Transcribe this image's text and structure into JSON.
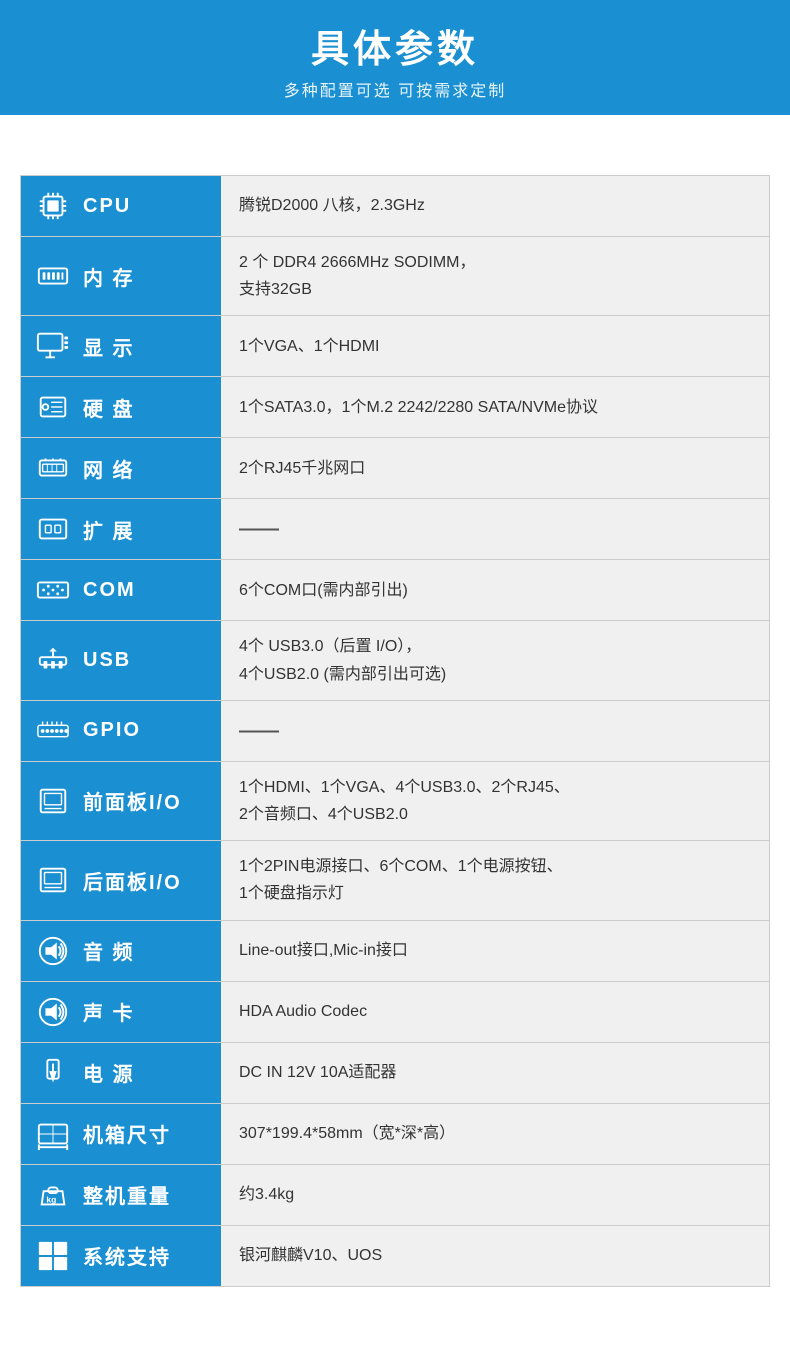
{
  "header": {
    "title": "具体参数",
    "subtitle": "多种配置可选 可按需求定制"
  },
  "rows": [
    {
      "id": "cpu",
      "label": "CPU",
      "value": "腾锐D2000 八核，2.3GHz",
      "icon": "cpu"
    },
    {
      "id": "memory",
      "label": "内 存",
      "value": "2 个 DDR4 2666MHz SODIMM，\n支持32GB",
      "icon": "memory"
    },
    {
      "id": "display",
      "label": "显 示",
      "value": "1个VGA、1个HDMI",
      "icon": "display"
    },
    {
      "id": "storage",
      "label": "硬 盘",
      "value": "1个SATA3.0，1个M.2 2242/2280 SATA/NVMe协议",
      "icon": "storage"
    },
    {
      "id": "network",
      "label": "网 络",
      "value": "2个RJ45千兆网口",
      "icon": "network"
    },
    {
      "id": "expansion",
      "label": "扩 展",
      "value": "——",
      "icon": "expansion"
    },
    {
      "id": "com",
      "label": "COM",
      "value": "6个COM口(需内部引出)",
      "icon": "com"
    },
    {
      "id": "usb",
      "label": "USB",
      "value": "4个 USB3.0（后置 I/O），\n4个USB2.0 (需内部引出可选)",
      "icon": "usb"
    },
    {
      "id": "gpio",
      "label": "GPIO",
      "value": "——",
      "icon": "gpio"
    },
    {
      "id": "front-io",
      "label": "前面板I/O",
      "value": "1个HDMI、1个VGA、4个USB3.0、2个RJ45、\n2个音频口、4个USB2.0",
      "icon": "front-panel"
    },
    {
      "id": "rear-io",
      "label": "后面板I/O",
      "value": "1个2PIN电源接口、6个COM、1个电源按钮、\n1个硬盘指示灯",
      "icon": "rear-panel"
    },
    {
      "id": "audio",
      "label": "音 频",
      "value": "Line-out接口,Mic-in接口",
      "icon": "audio"
    },
    {
      "id": "sound-card",
      "label": "声 卡",
      "value": "HDA Audio Codec",
      "icon": "sound-card"
    },
    {
      "id": "power",
      "label": "电 源",
      "value": "DC IN 12V 10A适配器",
      "icon": "power"
    },
    {
      "id": "size",
      "label": "机箱尺寸",
      "value": "307*199.4*58mm（宽*深*高）",
      "icon": "size"
    },
    {
      "id": "weight",
      "label": "整机重量",
      "value": "约3.4kg",
      "icon": "weight"
    },
    {
      "id": "os",
      "label": "系统支持",
      "value": "银河麒麟V10、UOS",
      "icon": "os"
    }
  ]
}
